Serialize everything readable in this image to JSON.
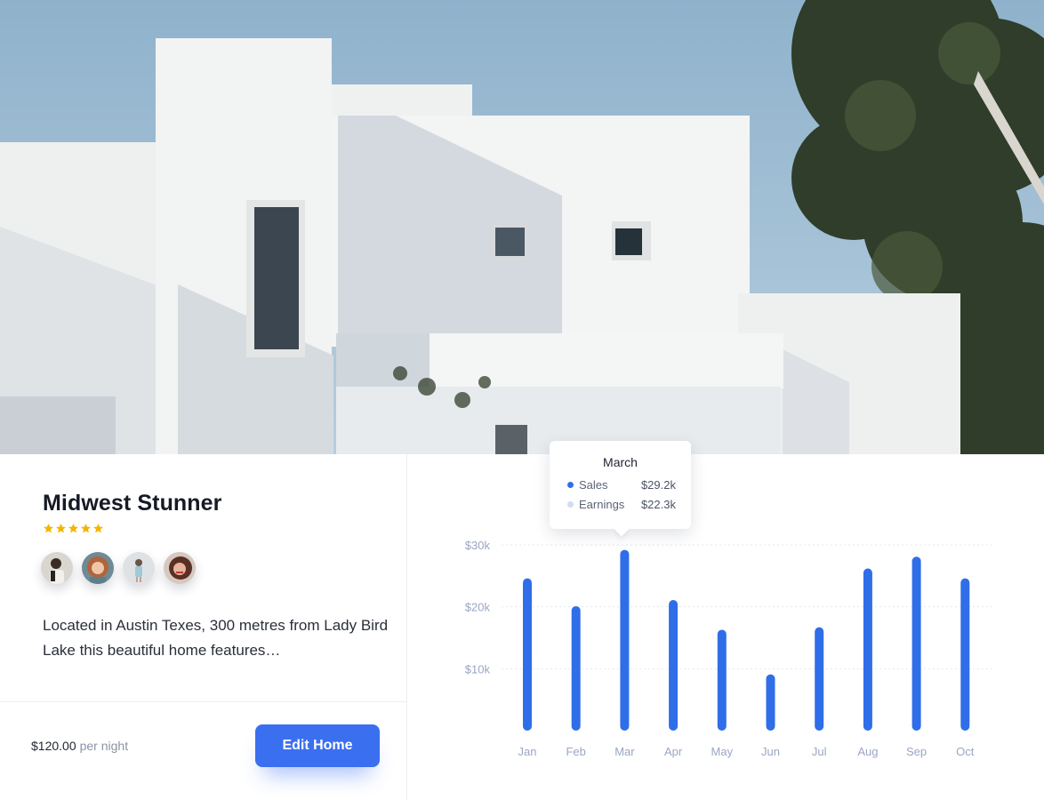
{
  "listing": {
    "title": "Midwest Stunner",
    "rating": 5,
    "description": "Located in Austin Texes, 300 metres from Lady Bird Lake this beautiful home features…",
    "price": "$120.00",
    "price_suffix": "per night",
    "edit_label": "Edit Home",
    "guests": [
      "guest-1",
      "guest-2",
      "guest-3",
      "guest-4"
    ]
  },
  "colors": {
    "accent": "#3a6ff0",
    "bar": "#2f6ee8",
    "star": "#f4b400",
    "earnings_dot": "#d3dcf5"
  },
  "tooltip": {
    "month": "March",
    "rows": [
      {
        "label": "Sales",
        "value": "$29.2k"
      },
      {
        "label": "Earnings",
        "value": "$22.3k"
      }
    ]
  },
  "chart_data": {
    "type": "bar",
    "categories": [
      "Jan",
      "Feb",
      "Mar",
      "Apr",
      "May",
      "Jun",
      "Jul",
      "Aug",
      "Sep",
      "Oct"
    ],
    "series": [
      {
        "name": "Sales",
        "values": [
          24.6,
          20.1,
          29.2,
          21.1,
          16.3,
          9.1,
          16.7,
          26.2,
          28.1,
          24.6
        ]
      }
    ],
    "y_ticks": [
      "$10k",
      "$20k",
      "$30k"
    ],
    "y_tick_values": [
      10,
      20,
      30
    ],
    "ylim": [
      0,
      30
    ],
    "grid": true,
    "highlight": "Mar"
  }
}
